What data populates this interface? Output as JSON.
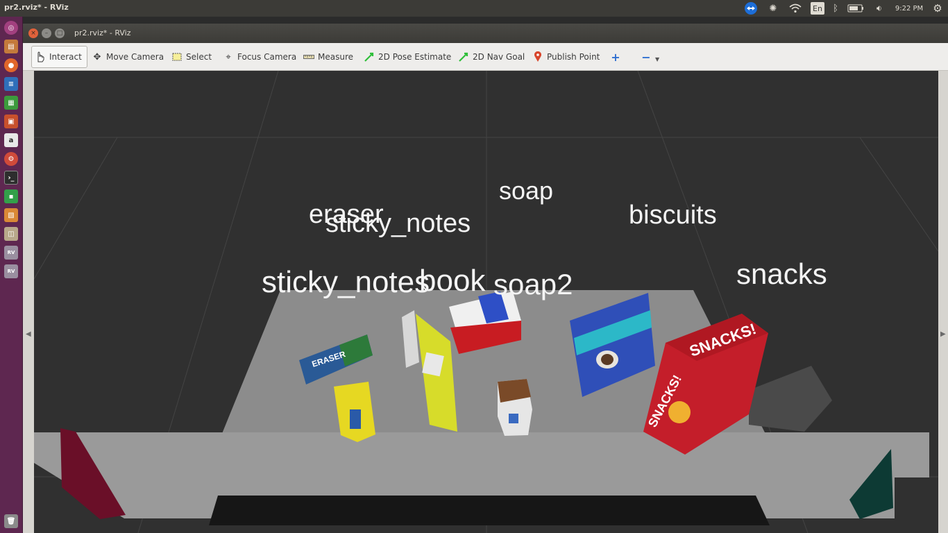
{
  "system": {
    "window_title": "pr2.rviz* - RViz",
    "keyboard": "En",
    "clock": "9:22 PM"
  },
  "window": {
    "title": "pr2.rviz* - RViz"
  },
  "toolbar": {
    "interact": "Interact",
    "move_camera": "Move Camera",
    "select": "Select",
    "focus_camera": "Focus Camera",
    "measure": "Measure",
    "pose_estimate": "2D Pose Estimate",
    "nav_goal": "2D Nav Goal",
    "publish_point": "Publish Point"
  },
  "scene": {
    "labels": {
      "soap": "soap",
      "biscuits": "biscuits",
      "eraser": "eraser",
      "sticky_notes_top": "sticky_notes",
      "sticky_notes_front": "sticky_notes",
      "book": "book",
      "soap2": "soap2",
      "snacks": "snacks"
    },
    "packages": {
      "eraser": "ERASER",
      "snacks": "SNACKS!"
    }
  }
}
